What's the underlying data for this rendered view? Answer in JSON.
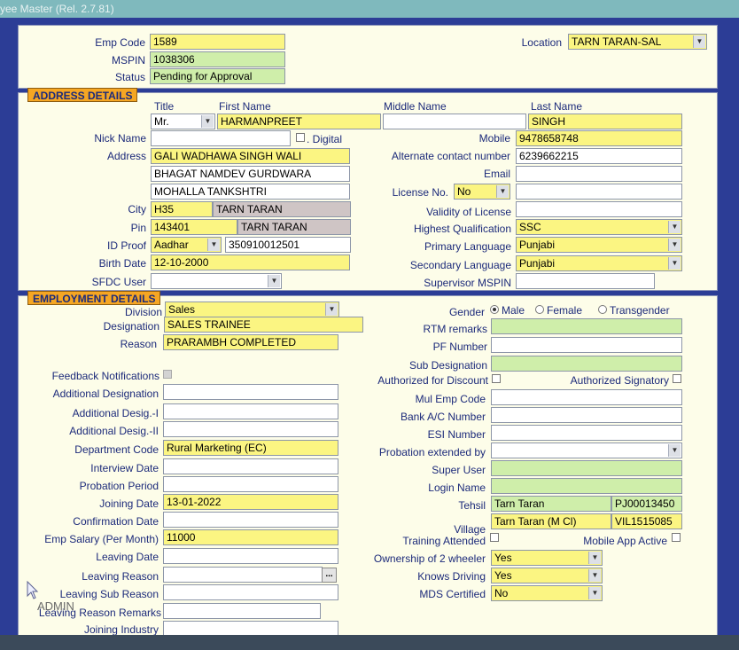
{
  "window": {
    "title": "yee Master (Rel. 2.7.81)"
  },
  "colors": {
    "yellow_field": "#fbf582",
    "green_field": "#cfeeaa",
    "grey_field": "#cfc5c5",
    "section_label": "#f5a623",
    "background": "#2c3d96",
    "panel": "#fdfde9"
  },
  "header": {
    "emp_code_label": "Emp Code",
    "emp_code": "1589",
    "mspin_label": "MSPIN",
    "mspin": "1038306",
    "status_label": "Status",
    "status": "Pending for Approval",
    "location_label": "Location",
    "location": "TARN TARAN-SAL"
  },
  "address": {
    "section_title": "ADDRESS DETAILS",
    "title_label": "Title",
    "title": "Mr.",
    "first_name_label": "First Name",
    "first_name": "HARMANPREET",
    "middle_name_label": "Middle Name",
    "middle_name": "",
    "last_name_label": "Last Name",
    "last_name": "SINGH",
    "nick_name_label": "Nick Name",
    "nick_name": "",
    "digital_label": ". Digital",
    "mobile_label": "Mobile",
    "mobile": "9478658748",
    "address_label": "Address",
    "address_line1": "GALI WADHAWA SINGH WALI",
    "address_line2": "BHAGAT NAMDEV GURDWARA",
    "address_line3": "MOHALLA TANKSHTRI",
    "alt_contact_label": "Alternate contact number",
    "alt_contact": "6239662215",
    "email_label": "Email",
    "email": "",
    "license_label": "License No.",
    "license_select": "No",
    "license_no": "",
    "city_label": "City",
    "city_code": "H35",
    "city_name": "TARN TARAN",
    "validity_label": "Validity of License",
    "validity": "",
    "pin_label": "Pin",
    "pin": "143401",
    "pin_city": "TARN TARAN",
    "highest_qual_label": "Highest Qualification",
    "highest_qual": "SSC",
    "id_proof_label": "ID Proof",
    "id_proof_type": "Aadhar",
    "id_proof_no": "350910012501",
    "primary_lang_label": "Primary Language",
    "primary_lang": "Punjabi",
    "birth_date_label": "Birth Date",
    "birth_date": "12-10-2000",
    "secondary_lang_label": "Secondary Language",
    "secondary_lang": "Punjabi",
    "sfdc_user_label": "SFDC User",
    "sfdc_user": "",
    "supervisor_mspin_label": "Supervisor MSPIN",
    "supervisor_mspin": ""
  },
  "employment": {
    "section_title": "EMPLOYMENT DETAILS",
    "division_label": "Division",
    "division": "Sales",
    "designation_label": "Designation",
    "designation": "SALES TRAINEE",
    "reason_label": "Reason",
    "reason": "PRARAMBH COMPLETED",
    "gender_label": "Gender",
    "gender_male": "Male",
    "gender_female": "Female",
    "gender_trans": "Transgender",
    "rtm_label": "RTM remarks",
    "rtm": "",
    "pf_label": "PF Number",
    "pf": "",
    "sub_desig_label": "Sub Designation",
    "sub_desig": "",
    "feedback_label": "Feedback Notifications",
    "auth_discount_label": "Authorized for Discount",
    "auth_signatory_label": "Authorized Signatory",
    "add_desig_label": "Additional Designation",
    "add_desig": "",
    "mul_emp_label": "Mul Emp Code",
    "mul_emp": "",
    "add_desig1_label": "Additional Desig.-I",
    "add_desig1": "",
    "bank_label": "Bank A/C Number",
    "bank": "",
    "add_desig2_label": "Additional Desig.-II",
    "add_desig2": "",
    "esi_label": "ESI Number",
    "esi": "",
    "dept_code_label": "Department Code",
    "dept_code": "Rural Marketing (EC)",
    "probation_ext_label": "Probation extended by",
    "probation_ext": "",
    "interview_label": "Interview Date",
    "interview": "",
    "super_user_label": "Super User",
    "super_user": "",
    "probation_label": "Probation Period",
    "probation": "",
    "login_label": "Login Name",
    "login": "",
    "joining_label": "Joining Date",
    "joining": "13-01-2022",
    "tehsil_label": "Tehsil",
    "tehsil": "Tarn Taran",
    "tehsil_code": "PJ00013450",
    "confirmation_label": "Confirmation Date",
    "confirmation": "",
    "village_label": "Village",
    "village": "Tarn Taran (M Cl)",
    "village_code": "VIL1515085",
    "salary_label": "Emp Salary (Per Month)",
    "salary": "11000",
    "training_label": "Training Attended",
    "mobile_app_label": "Mobile App Active",
    "leaving_date_label": "Leaving Date",
    "leaving_date": "",
    "two_wheeler_label": "Ownership of 2 wheeler",
    "two_wheeler": "Yes",
    "leaving_reason_label": "Leaving Reason",
    "leaving_reason": "",
    "knows_driving_label": "Knows Driving",
    "knows_driving": "Yes",
    "leaving_sub_label": "Leaving Sub Reason",
    "leaving_sub": "",
    "mds_label": "MDS Certified",
    "mds": "No",
    "leaving_remarks_label": "Leaving Reason Remarks",
    "leaving_remarks": "",
    "joining_industry_label": "Joining Industry",
    "joining_industry": ""
  },
  "overlay": {
    "admin_text": "ADMIN"
  }
}
